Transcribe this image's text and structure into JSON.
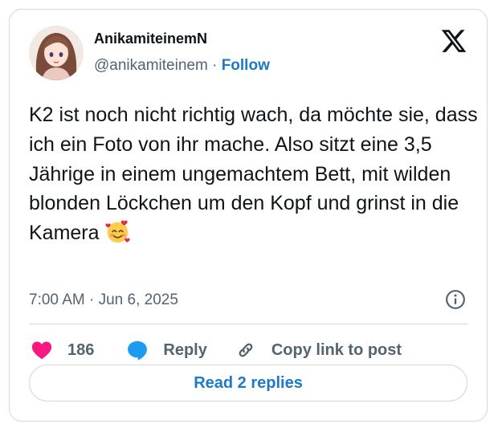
{
  "tweet": {
    "author": {
      "display_name": "AnikamiteinemN",
      "handle": "@anikamiteinem",
      "separator": " · ",
      "follow_label": "Follow",
      "avatar_icon": "avatar-illustration-woman"
    },
    "platform_icon": "x-logo-icon",
    "text": "K2 ist noch nicht richtig wach, da möchte sie, dass ich ein Foto von ihr mache. Also sitzt eine 3,5 Jährige in einem ungemachtem Bett, mit wilden blonden Löckchen um den Kopf und grinst in die Kamera",
    "text_emoji": "smiling-face-with-hearts-icon",
    "timestamp": "7:00 AM · Jun 6, 2025",
    "info_icon": "info-icon",
    "actions": {
      "likes_count": "186",
      "reply_label": "Reply",
      "copy_link_label": "Copy link to post"
    },
    "read_replies_label": "Read 2 replies"
  },
  "colors": {
    "accent_blue": "#1d79c9",
    "like_pink": "#f91880",
    "reply_blue": "#1d9bf0",
    "secondary_text": "#536471",
    "border": "#cfd9de"
  }
}
